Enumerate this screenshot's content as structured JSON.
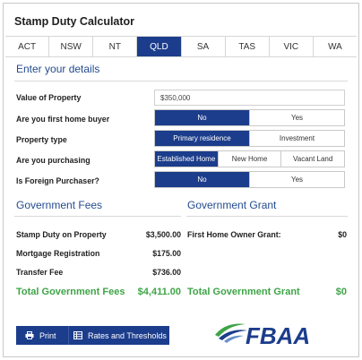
{
  "title": "Stamp Duty Calculator",
  "tabs": [
    "ACT",
    "NSW",
    "NT",
    "QLD",
    "SA",
    "TAS",
    "VIC",
    "WA"
  ],
  "active_tab": "QLD",
  "details": {
    "heading": "Enter your details",
    "value_label": "Value of Property",
    "value_input": "$350,000",
    "first_home_label": "Are you first home buyer",
    "first_home_options": [
      "No",
      "Yes"
    ],
    "property_type_label": "Property type",
    "property_type_options": [
      "Primary residence",
      "Investment"
    ],
    "purchasing_label": "Are you purchasing",
    "purchasing_options": [
      "Established Home",
      "New Home",
      "Vacant Land"
    ],
    "foreign_label": "Is Foreign Purchaser?",
    "foreign_options": [
      "No",
      "Yes"
    ]
  },
  "fees": {
    "heading": "Government Fees",
    "stamp_duty_label": "Stamp Duty on Property",
    "stamp_duty_value": "$3,500.00",
    "mortgage_label": "Mortgage Registration",
    "mortgage_value": "$175.00",
    "transfer_label": "Transfer Fee",
    "transfer_value": "$736.00",
    "total_label": "Total Government Fees",
    "total_value": "$4,411.00"
  },
  "grant": {
    "heading": "Government Grant",
    "first_home_label": "First Home Owner Grant:",
    "first_home_value": "$0",
    "total_label": "Total Government Grant",
    "total_value": "$0"
  },
  "buttons": {
    "print": "Print",
    "rates": "Rates and Thresholds"
  },
  "logo_text": "FBAA",
  "colors": {
    "brand_blue": "#1c3d8c",
    "heading_blue": "#234b8f",
    "total_green": "#3ea447"
  },
  "icons": [
    "printer-icon",
    "table-icon",
    "fbaa-logo"
  ]
}
